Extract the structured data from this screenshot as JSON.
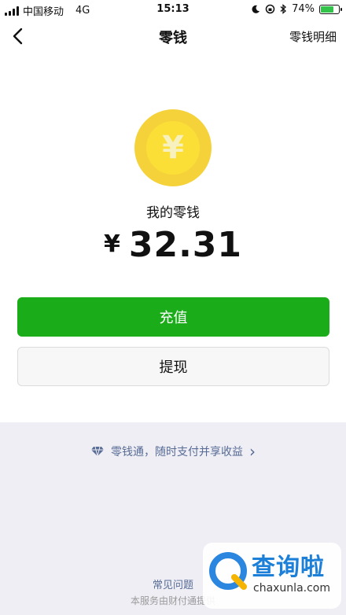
{
  "status_bar": {
    "carrier": "中国移动",
    "network": "4G",
    "time": "15:13",
    "battery_percent": "74%",
    "battery_level": 0.74
  },
  "nav": {
    "title": "零钱",
    "right_link": "零钱明细"
  },
  "balance": {
    "label": "我的零钱",
    "currency_symbol": "¥",
    "amount": "32.31",
    "coin_symbol": "¥"
  },
  "actions": {
    "recharge_label": "充值",
    "withdraw_label": "提现"
  },
  "bottom": {
    "lct_text": "零钱通，随时支付并享收益",
    "lct_arrow": "›",
    "faq_label": "常见问题",
    "footer": "本服务由财付通提供"
  },
  "watermark": {
    "title": "查询啦",
    "url": "chaxunla.com"
  },
  "colors": {
    "primary_green": "#1aad19",
    "link_blue": "#576b95",
    "coin_yellow": "#fbdf36"
  }
}
